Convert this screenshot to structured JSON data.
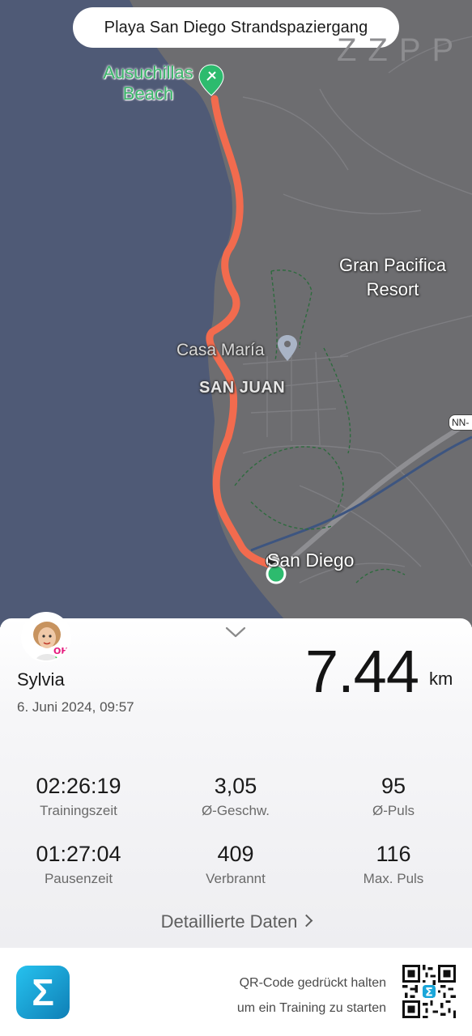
{
  "map": {
    "route_title": "Playa San Diego Strandspaziergang",
    "watermark": "ZZPP",
    "labels": {
      "beach": "Ausuchillas Beach",
      "resort": "Gran Pacifica Resort",
      "casa": "Casa María",
      "san_juan": "SAN JUAN",
      "san_diego": "San Diego",
      "road": "NN-"
    },
    "colors": {
      "water": "#4f5a76",
      "land": "#6d6d70",
      "route": "#f26b4e",
      "start_marker": "#2dbb6e"
    }
  },
  "summary": {
    "user_name": "Sylvia",
    "date": "6. Juni 2024, 09:57",
    "distance": "7.44",
    "distance_unit": "km",
    "stats": [
      {
        "value": "02:26:19",
        "label": "Trainingszeit"
      },
      {
        "value": "3,05",
        "label": "Ø-Geschw."
      },
      {
        "value": "95",
        "label": "Ø-Puls"
      },
      {
        "value": "01:27:04",
        "label": "Pausenzeit"
      },
      {
        "value": "409",
        "label": "Verbrannt"
      },
      {
        "value": "116",
        "label": "Max. Puls"
      }
    ],
    "details_link": "Detaillierte Daten"
  },
  "footer": {
    "app_icon": "zepp-sigma-icon",
    "qr_text_line1": "QR-Code gedrückt halten",
    "qr_text_line2": "um ein Training zu starten"
  }
}
